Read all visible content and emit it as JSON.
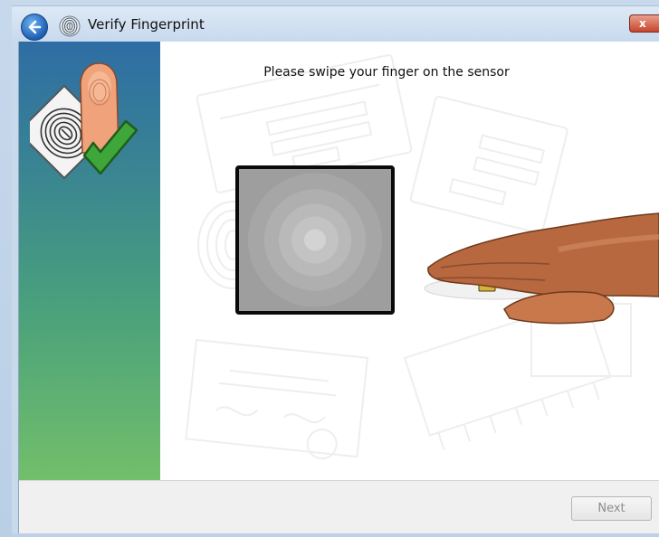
{
  "window": {
    "title": "Verify Fingerprint",
    "close_label": "x"
  },
  "icons": {
    "back": "back-arrow-icon",
    "title": "fingerprint-icon",
    "sidebar": "fingerprint-check-icon",
    "hand": "hand-swipe-illustration"
  },
  "main": {
    "instruction": "Please swipe your finger on the sensor"
  },
  "footer": {
    "next_label": "Next"
  },
  "colors": {
    "sidebar_top": "#2e6da4",
    "sidebar_bottom": "#72bf6a",
    "check_green": "#3fa63a"
  }
}
